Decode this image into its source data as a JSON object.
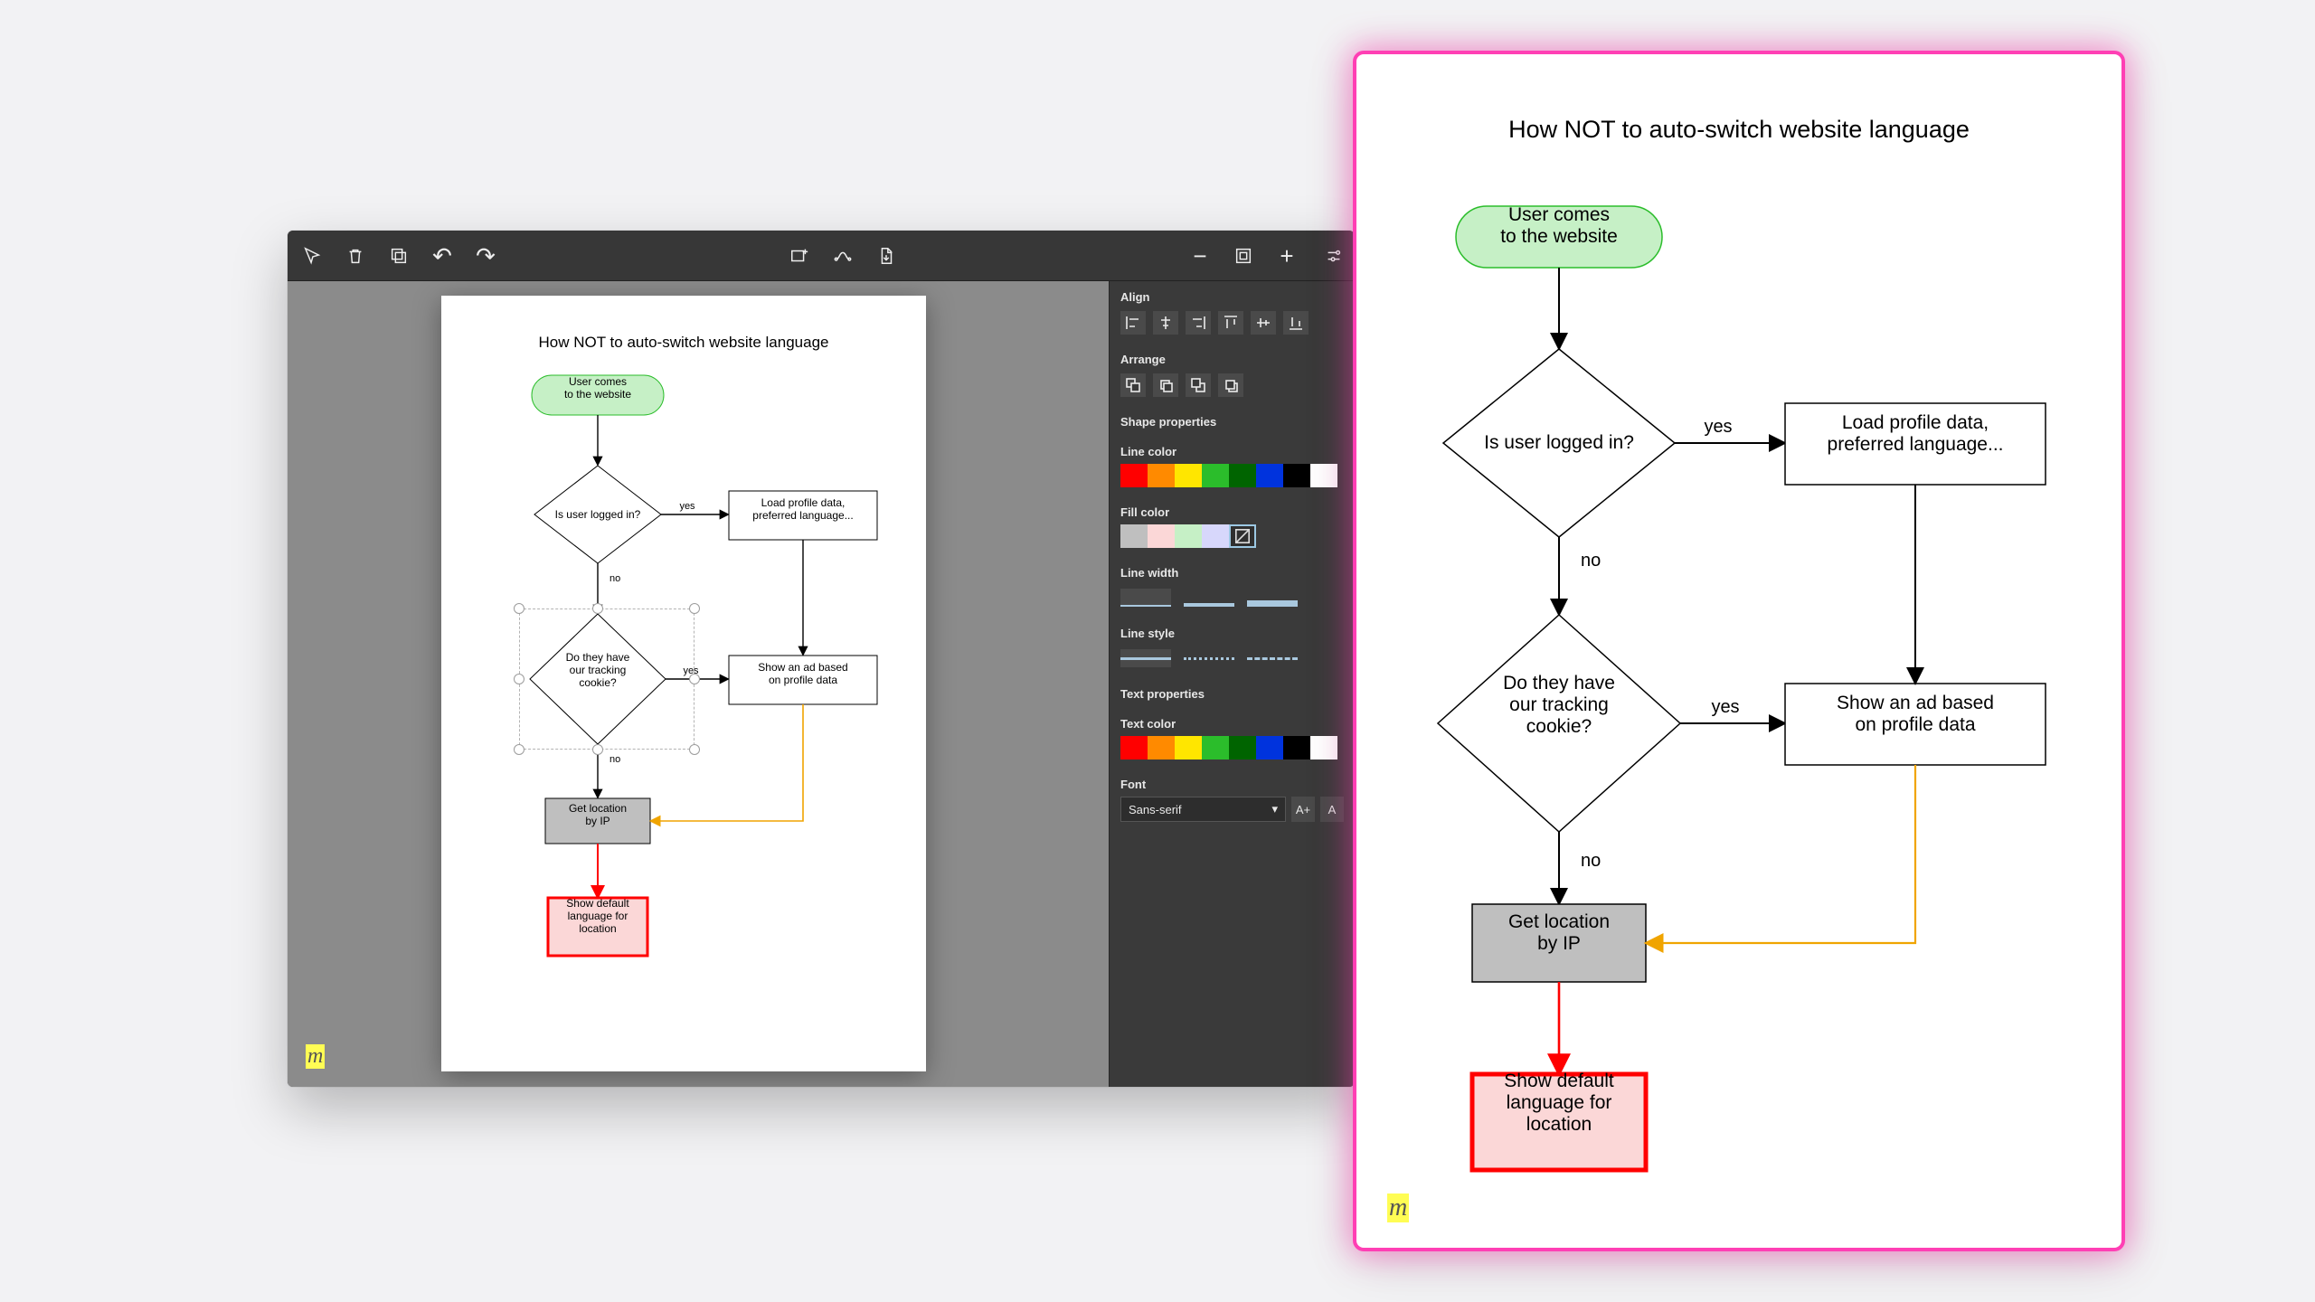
{
  "editor": {
    "doc_title": "How NOT to auto-switch website language",
    "watermark": "m"
  },
  "preview": {
    "doc_title": "How NOT to auto-switch website language",
    "watermark": "m"
  },
  "flow": {
    "start": "User comes\nto the website",
    "decision1": "Is user logged in?",
    "decision1_yes": "yes",
    "decision1_no": "no",
    "process1": "Load profile data,\npreferred language...",
    "decision2": "Do they have\nour tracking\ncookie?",
    "decision2_yes": "yes",
    "decision2_no": "no",
    "process2": "Show an ad based\non profile data",
    "process3": "Get location\nby IP",
    "terminal": "Show default\nlanguage for\nlocation"
  },
  "panel": {
    "section_align": "Align",
    "section_arrange": "Arrange",
    "section_shape": "Shape properties",
    "label_linecolor": "Line color",
    "label_fillcolor": "Fill color",
    "label_linewidth": "Line width",
    "label_linestyle": "Line style",
    "section_text": "Text properties",
    "label_textcolor": "Text color",
    "label_font": "Font",
    "font_selected": "Sans-serif",
    "font_inc": "A+",
    "font_dec": "A"
  },
  "colors": {
    "line_palette": [
      "#ff0000",
      "#ff8a00",
      "#ffe600",
      "#2bbd2b",
      "#006400",
      "#0033dd",
      "#000000",
      "#ffffff"
    ],
    "fill_palette": [
      "#bfbfbf",
      "#fbd7d7",
      "#c6f0c6",
      "#d7d7fb"
    ],
    "text_palette": [
      "#ff0000",
      "#ff8a00",
      "#ffe600",
      "#2bbd2b",
      "#006400",
      "#0033dd",
      "#000000",
      "#ffffff"
    ]
  }
}
